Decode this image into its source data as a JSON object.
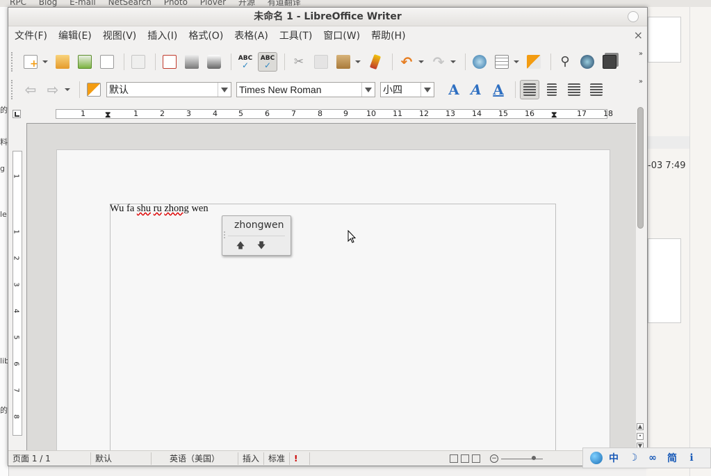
{
  "window": {
    "title": "未命名 1 - LibreOffice Writer"
  },
  "background": {
    "bookmarks": [
      "RPC",
      "Blog",
      "E-mail",
      "NetSearch",
      "Photo",
      "Plover",
      "开源",
      "有道翻译"
    ],
    "right_timestamp": "-03 7:49",
    "left_fragments": [
      "的",
      "料",
      "g",
      "le",
      "lib",
      "的"
    ]
  },
  "menubar": {
    "items": [
      "文件(F)",
      "编辑(E)",
      "视图(V)",
      "插入(I)",
      "格式(O)",
      "表格(A)",
      "工具(T)",
      "窗口(W)",
      "帮助(H)"
    ],
    "close_symbol": "×"
  },
  "toolbar_standard": {
    "icons": [
      "new-document-icon",
      "open-folder-icon",
      "save-icon",
      "export-mail-icon",
      "edit-mode-icon",
      "export-pdf-icon",
      "print-icon",
      "print-preview-icon",
      "spellcheck-icon",
      "auto-spellcheck-icon",
      "cut-icon",
      "copy-icon",
      "paste-icon",
      "clone-formatting-icon",
      "undo-icon",
      "redo-icon",
      "hyperlink-icon",
      "table-icon",
      "draw-functions-icon",
      "find-replace-icon",
      "navigator-icon",
      "gallery-icon"
    ],
    "spell_label": "ABC",
    "overflow_symbol": "»"
  },
  "toolbar_formatting": {
    "paragraph_style": "默认",
    "font_name": "Times New Roman",
    "font_size": "小四",
    "font_glyph": "A",
    "overflow_symbol": "»"
  },
  "ruler": {
    "numbers": [
      "1",
      "1",
      "2",
      "3",
      "4",
      "5",
      "6",
      "7",
      "8",
      "9",
      "10",
      "11",
      "12",
      "13",
      "14",
      "15",
      "16",
      "17",
      "18"
    ],
    "vertical_numbers": [
      "1",
      "1",
      "2",
      "3",
      "4",
      "5",
      "6",
      "7",
      "8"
    ]
  },
  "document": {
    "words": [
      "Wu",
      "fa",
      "shu",
      "ru",
      "zhong",
      "wen"
    ],
    "spelling_error_flags": [
      false,
      false,
      true,
      true,
      true,
      false
    ]
  },
  "ime_popup": {
    "candidate": "zhongwen",
    "up_symbol": "🡅",
    "down_symbol": "🡇"
  },
  "statusbar": {
    "page": "页面 1 / 1",
    "style": "默认",
    "language": "英语（美国）",
    "insert_mode": "插入",
    "selection_mode": "标准",
    "signature": "!"
  },
  "tray": {
    "icons": [
      "globe-icon",
      "chinese-mode-icon",
      "moon-icon",
      "punctuation-icon",
      "simplified-icon",
      "info-icon"
    ],
    "labels": [
      "中",
      "☽",
      "∞",
      "简",
      "ℹ"
    ]
  }
}
